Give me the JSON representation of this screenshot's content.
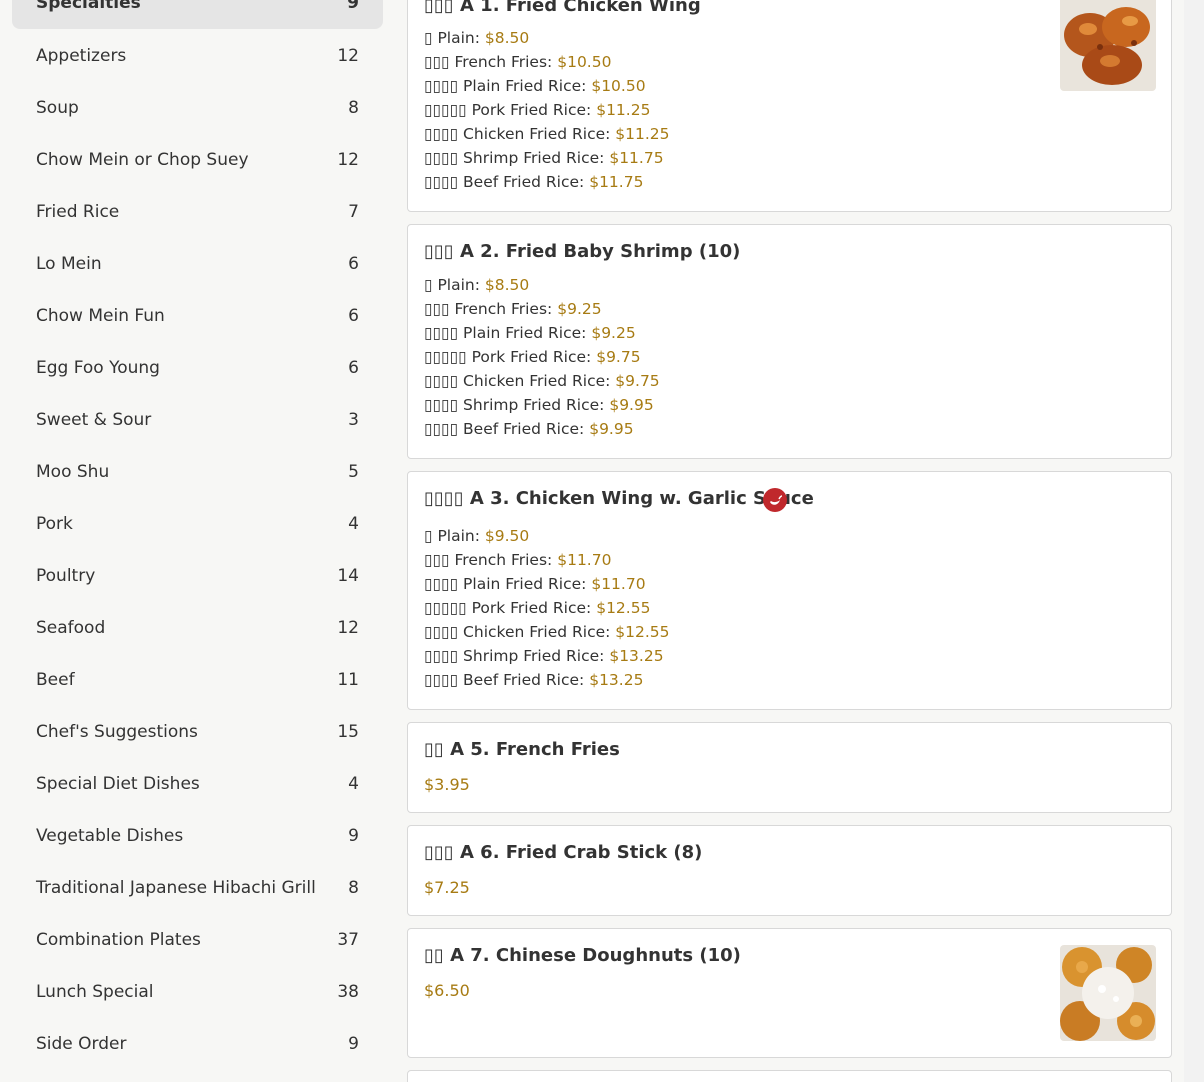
{
  "categories": [
    {
      "name": "Specialties",
      "count": "9"
    },
    {
      "name": "Appetizers",
      "count": "12"
    },
    {
      "name": "Soup",
      "count": "8"
    },
    {
      "name": "Chow Mein or Chop Suey",
      "count": "12"
    },
    {
      "name": "Fried Rice",
      "count": "7"
    },
    {
      "name": "Lo Mein",
      "count": "6"
    },
    {
      "name": "Chow Mein Fun",
      "count": "6"
    },
    {
      "name": "Egg Foo Young",
      "count": "6"
    },
    {
      "name": "Sweet & Sour",
      "count": "3"
    },
    {
      "name": "Moo Shu",
      "count": "5"
    },
    {
      "name": "Pork",
      "count": "4"
    },
    {
      "name": "Poultry",
      "count": "14"
    },
    {
      "name": "Seafood",
      "count": "12"
    },
    {
      "name": "Beef",
      "count": "11"
    },
    {
      "name": "Chef's Suggestions",
      "count": "15"
    },
    {
      "name": "Special Diet Dishes",
      "count": "4"
    },
    {
      "name": "Vegetable Dishes",
      "count": "9"
    },
    {
      "name": "Traditional Japanese Hibachi Grill",
      "count": "8"
    },
    {
      "name": "Combination Plates",
      "count": "37"
    },
    {
      "name": "Lunch Special",
      "count": "38"
    },
    {
      "name": "Side Order",
      "count": "9"
    }
  ],
  "items": [
    {
      "title": "▯▯▯ A 1. Fried Chicken Wing",
      "options": [
        {
          "label": "▯ Plain:",
          "price": "$8.50"
        },
        {
          "label": "▯▯▯ French Fries:",
          "price": "$10.50"
        },
        {
          "label": "▯▯▯▯ Plain Fried Rice:",
          "price": "$10.50"
        },
        {
          "label": "▯▯▯▯▯ Pork Fried Rice:",
          "price": "$11.25"
        },
        {
          "label": "▯▯▯▯ Chicken Fried Rice:",
          "price": "$11.25"
        },
        {
          "label": "▯▯▯▯ Shrimp Fried Rice:",
          "price": "$11.75"
        },
        {
          "label": "▯▯▯▯ Beef Fried Rice:",
          "price": "$11.75"
        }
      ]
    },
    {
      "title": "▯▯▯ A 2. Fried Baby Shrimp (10)",
      "options": [
        {
          "label": "▯ Plain:",
          "price": "$8.50"
        },
        {
          "label": "▯▯▯ French Fries:",
          "price": "$9.25"
        },
        {
          "label": "▯▯▯▯ Plain Fried Rice:",
          "price": "$9.25"
        },
        {
          "label": "▯▯▯▯▯ Pork Fried Rice:",
          "price": "$9.75"
        },
        {
          "label": "▯▯▯▯ Chicken Fried Rice:",
          "price": "$9.75"
        },
        {
          "label": "▯▯▯▯ Shrimp Fried Rice:",
          "price": "$9.95"
        },
        {
          "label": "▯▯▯▯ Beef Fried Rice:",
          "price": "$9.95"
        }
      ]
    },
    {
      "title": "▯▯▯▯ A 3. Chicken Wing w. Garlic Sauce",
      "options": [
        {
          "label": "▯ Plain:",
          "price": "$9.50"
        },
        {
          "label": "▯▯▯ French Fries:",
          "price": "$11.70"
        },
        {
          "label": "▯▯▯▯ Plain Fried Rice:",
          "price": "$11.70"
        },
        {
          "label": "▯▯▯▯▯ Pork Fried Rice:",
          "price": "$12.55"
        },
        {
          "label": "▯▯▯▯ Chicken Fried Rice:",
          "price": "$12.55"
        },
        {
          "label": "▯▯▯▯ Shrimp Fried Rice:",
          "price": "$13.25"
        },
        {
          "label": "▯▯▯▯ Beef Fried Rice:",
          "price": "$13.25"
        }
      ]
    },
    {
      "title": "▯▯ A 5. French Fries",
      "price": "$3.95"
    },
    {
      "title": "▯▯▯ A 6. Fried Crab Stick (8)",
      "price": "$7.25"
    },
    {
      "title": "▯▯ A 7. Chinese Doughnuts (10)",
      "price": "$6.50"
    }
  ],
  "icons": {
    "spicy": "chili-pepper-icon"
  },
  "colors": {
    "price": "#a77b13",
    "spicy": "#c0282c",
    "active_category_bg": "#e5e5e5"
  }
}
